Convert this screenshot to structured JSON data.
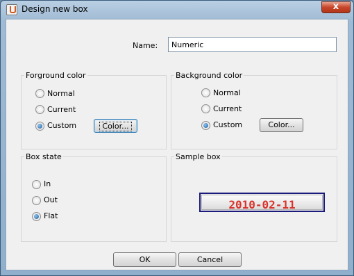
{
  "window": {
    "title": "Design new box",
    "close_symbol": "x"
  },
  "name": {
    "label": "Name:",
    "value": "Numeric"
  },
  "foreground": {
    "title": "Forground color",
    "options": [
      "Normal",
      "Current",
      "Custom"
    ],
    "selected": "Custom",
    "color_button": "Color..."
  },
  "background": {
    "title": "Background color",
    "options": [
      "Normal",
      "Current",
      "Custom"
    ],
    "selected": "Custom",
    "color_button": "Color..."
  },
  "box_state": {
    "title": "Box state",
    "options": [
      "In",
      "Out",
      "Flat"
    ],
    "selected": "Flat"
  },
  "sample": {
    "title": "Sample box",
    "text": "2010-02-11",
    "text_color": "#d9342b",
    "border_color": "#1a1a7a"
  },
  "buttons": {
    "ok": "OK",
    "cancel": "Cancel"
  }
}
